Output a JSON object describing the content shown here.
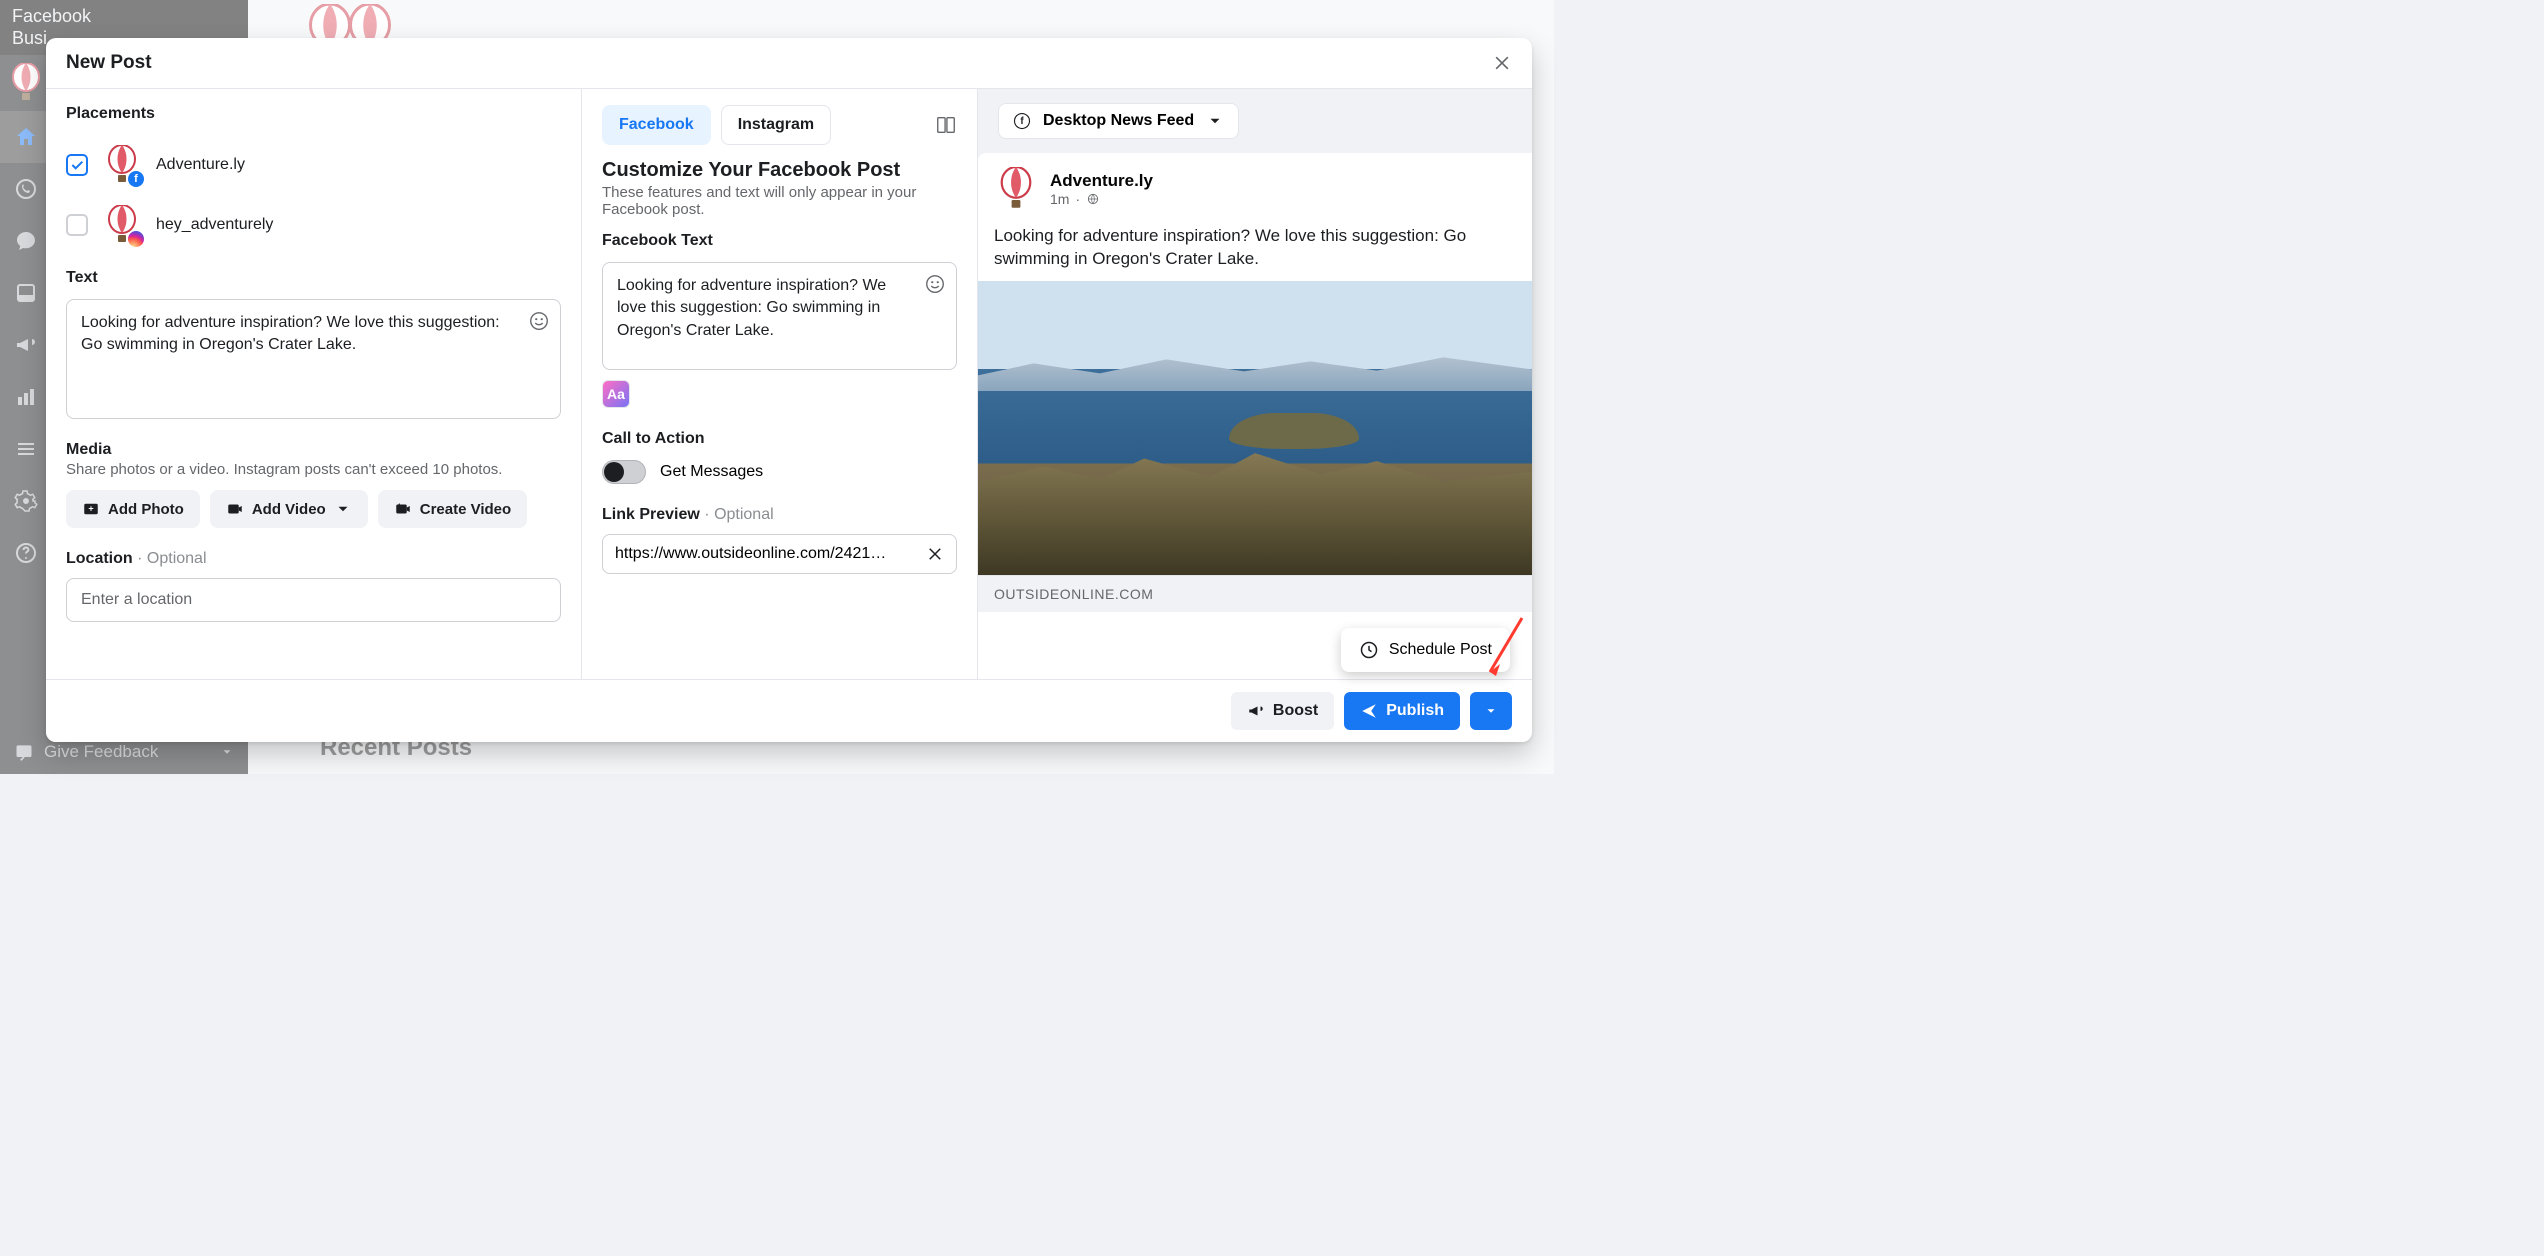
{
  "sidebar": {
    "brand_line1": "Facebook",
    "brand_line2": "Busi",
    "feedback_label": "Give Feedback"
  },
  "background": {
    "recent_posts": "Recent Posts"
  },
  "modal": {
    "title": "New Post"
  },
  "placements": {
    "label": "Placements",
    "items": [
      {
        "name": "Adventure.ly",
        "network": "facebook",
        "checked": true
      },
      {
        "name": "hey_adventurely",
        "network": "instagram",
        "checked": false
      }
    ]
  },
  "text": {
    "label": "Text",
    "value": "Looking for adventure inspiration? We love this suggestion: Go swimming in Oregon's Crater Lake."
  },
  "media": {
    "label": "Media",
    "hint": "Share photos or a video. Instagram posts can't exceed 10 photos.",
    "add_photo": "Add Photo",
    "add_video": "Add Video",
    "create_video": "Create Video"
  },
  "location": {
    "label": "Location",
    "optional": "Optional",
    "placeholder": "Enter a location"
  },
  "customize": {
    "tabs": {
      "facebook": "Facebook",
      "instagram": "Instagram"
    },
    "heading": "Customize Your Facebook Post",
    "hint": "These features and text will only appear in your Facebook post.",
    "fb_text_label": "Facebook Text",
    "fb_text_value": "Looking for adventure inspiration? We love this suggestion: Go swimming in Oregon's Crater Lake.",
    "cta_label": "Call to Action",
    "cta_toggle_label": "Get Messages",
    "link_preview_label": "Link Preview",
    "link_preview_optional": "Optional",
    "link_url_display": "https://www.outsideonline.com/2421…",
    "aa": "Aa"
  },
  "preview": {
    "feed_selector": "Desktop News Feed",
    "page_name": "Adventure.ly",
    "time": "1m",
    "post_text": "Looking for adventure inspiration? We love this suggestion: Go swimming in Oregon's Crater Lake.",
    "link_domain": "OUTSIDEONLINE.COM"
  },
  "footer": {
    "boost": "Boost",
    "publish": "Publish",
    "schedule": "Schedule Post"
  }
}
